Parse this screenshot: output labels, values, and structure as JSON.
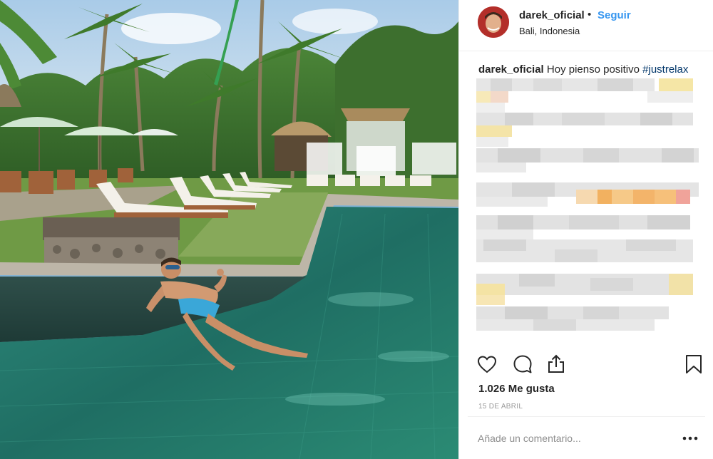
{
  "post": {
    "username": "darek_oficial",
    "separator": "•",
    "follow_label": "Seguir",
    "location": "Bali, Indonesia",
    "caption": {
      "username": "darek_oficial",
      "text": "Hoy pienso positivo",
      "hashtag": "#justrelax"
    },
    "likes_text": "1.026 Me gusta",
    "date_text": "15 DE ABRIL",
    "comment_placeholder": "Añade un comentario...",
    "icons": {
      "like": "heart-icon",
      "comment": "comment-bubble-icon",
      "share": "share-upload-icon",
      "save": "bookmark-icon",
      "more": "more-options-icon"
    },
    "colors": {
      "link_blue": "#3897f0",
      "hashtag": "#003569",
      "muted": "#999999"
    }
  }
}
